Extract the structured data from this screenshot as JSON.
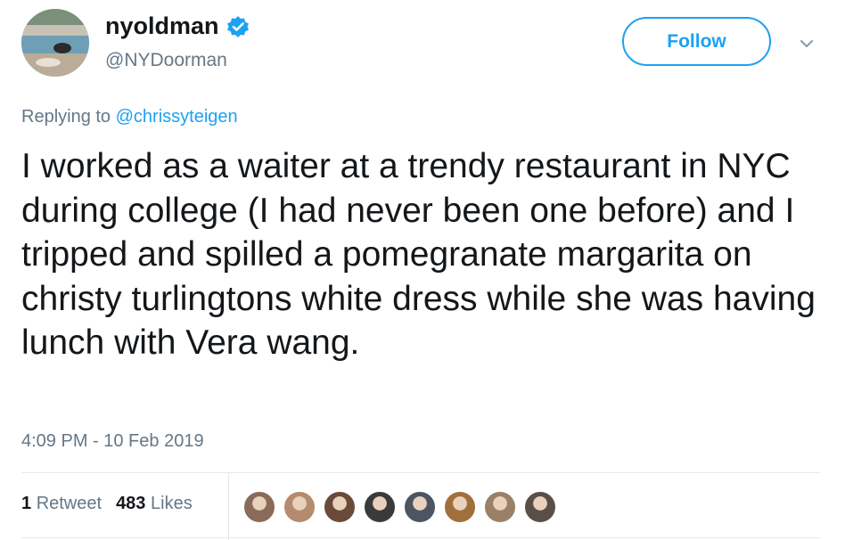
{
  "user": {
    "display_name": "nyoldman",
    "handle": "@NYDoorman",
    "verified_icon": "verified-badge-icon",
    "avatar_icon": "pool-photo-avatar"
  },
  "follow_button": {
    "label": "Follow"
  },
  "more_menu": {
    "icon": "chevron-down-icon"
  },
  "reply": {
    "prefix": "Replying to",
    "to": "@chrissyteigen"
  },
  "tweet": {
    "text": "I worked as a waiter at a trendy restaurant in NYC during college (I had never been one before) and I tripped and spilled a pomegranate margarita on christy turlingtons white dress while she was having lunch with Vera wang.",
    "timestamp": "4:09 PM - 10 Feb 2019"
  },
  "stats": {
    "retweets_count": "1",
    "retweets_label": "Retweet",
    "likes_count": "483",
    "likes_label": "Likes"
  },
  "likers": [
    {
      "name": "liker-avatar-1",
      "color": "#8a6a58"
    },
    {
      "name": "liker-avatar-2",
      "color": "#b48b6e"
    },
    {
      "name": "liker-avatar-3",
      "color": "#6b4a3a"
    },
    {
      "name": "liker-avatar-4",
      "color": "#3a3a3a"
    },
    {
      "name": "liker-avatar-5",
      "color": "#4c5560"
    },
    {
      "name": "liker-avatar-6",
      "color": "#a0703c"
    },
    {
      "name": "liker-avatar-7",
      "color": "#9a8066"
    },
    {
      "name": "liker-avatar-8",
      "color": "#5a4e48"
    }
  ],
  "colors": {
    "accent": "#1da1f2",
    "text": "#14171a",
    "muted": "#657786",
    "border": "#e1e8ed"
  }
}
